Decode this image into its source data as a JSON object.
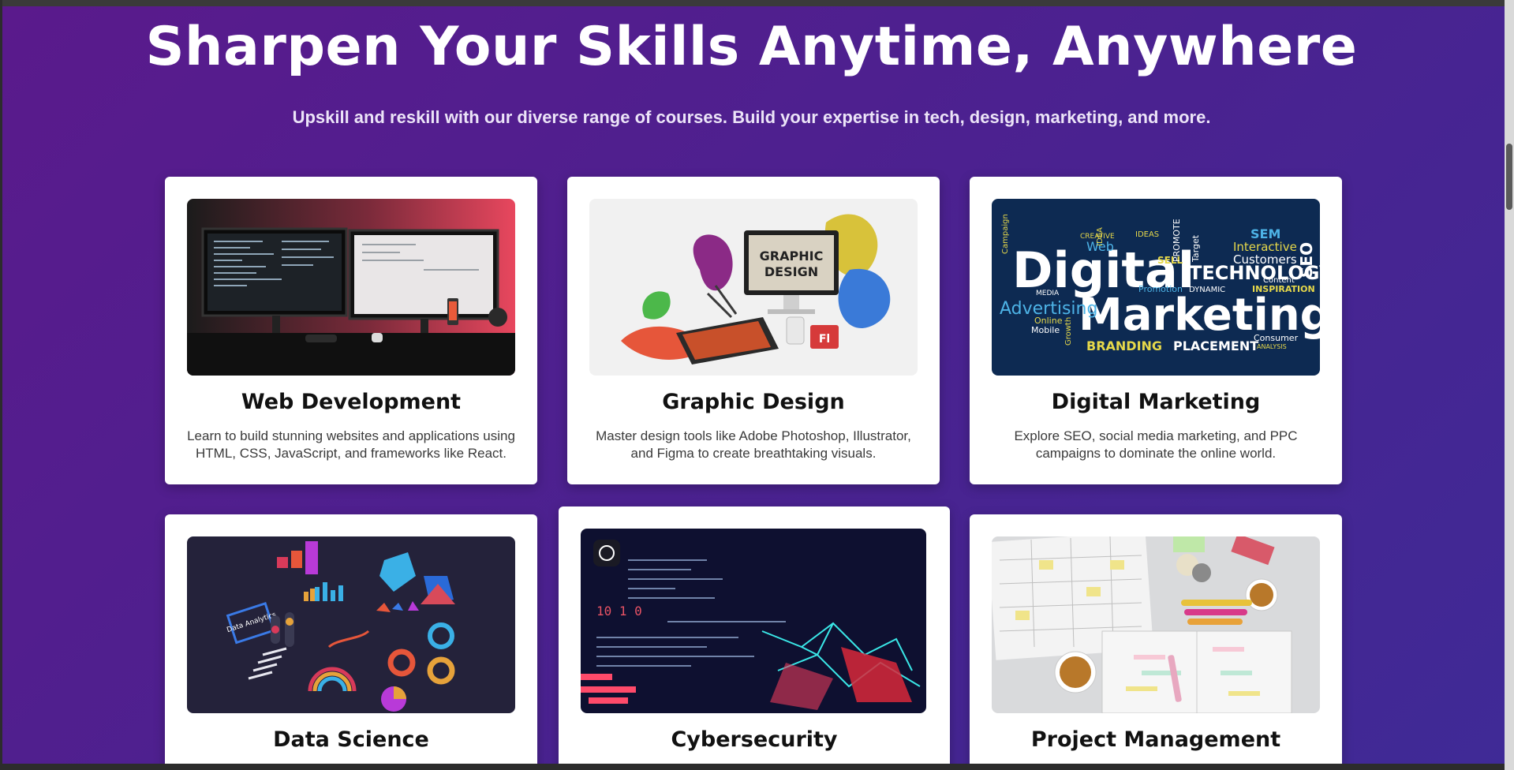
{
  "hero": {
    "title": "Sharpen Your Skills Anytime, Anywhere",
    "subtitle": "Upskill and reskill with our diverse range of courses. Build your expertise in tech, design, marketing, and more."
  },
  "courses": [
    {
      "title": "Web Development",
      "description": "Learn to build stunning websites and applications using HTML, CSS, JavaScript, and frameworks like React.",
      "image_icon": "dual-monitor-desk-image"
    },
    {
      "title": "Graphic Design",
      "description": "Master design tools like Adobe Photoshop, Illustrator, and Figma to create breathtaking visuals.",
      "image_icon": "graphic-design-splash-image",
      "image_text": "GRAPHIC DESIGN"
    },
    {
      "title": "Digital Marketing",
      "description": "Explore SEO, social media marketing, and PPC campaigns to dominate the online world.",
      "image_icon": "digital-marketing-word-cloud-image",
      "image_words": [
        "Digital",
        "Marketing",
        "TECHNOLOGY",
        "Advertising",
        "BRANDING",
        "PLACEMENT",
        "SEM",
        "SEO",
        "Interactive",
        "Customers",
        "Web",
        "IDEA",
        "Campaign",
        "MEDIA",
        "Online",
        "Mobile",
        "Promotion",
        "DYNAMIC",
        "INSPIRATION",
        "Content",
        "Consumer",
        "SELL",
        "Target",
        "CREATIVE",
        "IDEAS",
        "PROMOTE",
        "Growth",
        "ANALYSIS"
      ]
    },
    {
      "title": "Data Science",
      "description": "",
      "image_icon": "data-analytics-3d-image",
      "image_text": "Data Analytics"
    },
    {
      "title": "Cybersecurity",
      "description": "",
      "image_icon": "cybersecurity-code-image"
    },
    {
      "title": "Project Management",
      "description": "",
      "image_icon": "planner-desk-image"
    }
  ],
  "colors": {
    "background_start": "#5a1a8c",
    "background_end": "#3f2a96",
    "card": "#ffffff",
    "title_text": "#ffffff"
  }
}
